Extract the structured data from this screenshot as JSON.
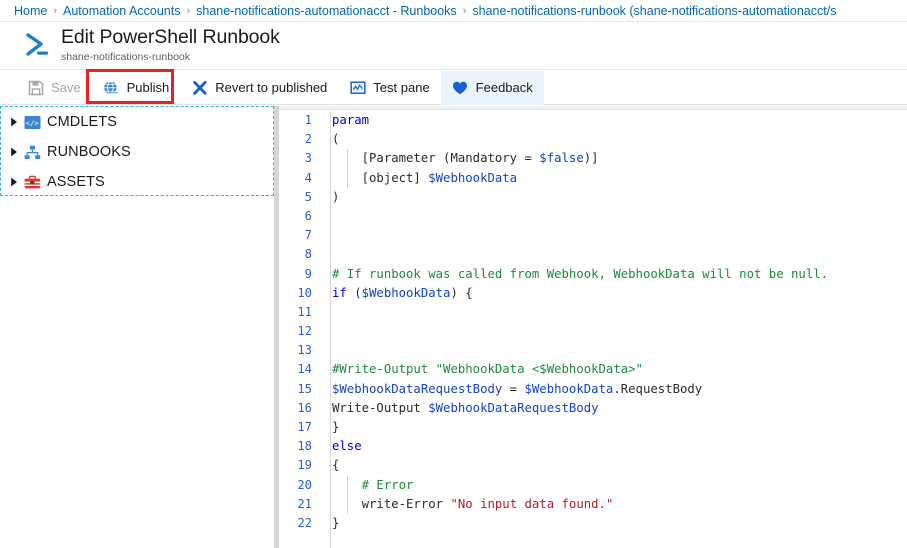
{
  "breadcrumb": {
    "items": [
      {
        "label": "Home"
      },
      {
        "label": "Automation Accounts"
      },
      {
        "label": "shane-notifications-automationacct - Runbooks"
      },
      {
        "label": "shane-notifications-runbook (shane-notifications-automationacct/s"
      }
    ],
    "separator": "›"
  },
  "header": {
    "title": "Edit PowerShell Runbook",
    "subtitle": "shane-notifications-runbook",
    "icon": "powershell-prompt-icon"
  },
  "toolbar": {
    "buttons": [
      {
        "label": "Save",
        "icon": "save-floppy-icon",
        "disabled": true,
        "hovered": false
      },
      {
        "label": "Publish",
        "icon": "publish-globe-icon",
        "disabled": false,
        "hovered": false,
        "highlighted": true
      },
      {
        "label": "Revert to published",
        "icon": "revert-x-icon",
        "disabled": false,
        "hovered": false
      },
      {
        "label": "Test pane",
        "icon": "test-pane-monitor-icon",
        "disabled": false,
        "hovered": false
      },
      {
        "label": "Feedback",
        "icon": "feedback-heart-icon",
        "disabled": false,
        "hovered": true
      }
    ]
  },
  "annotation": {
    "color": "#e8201f",
    "target": "Publish"
  },
  "sidebar": {
    "items": [
      {
        "label": "CMDLETS",
        "icon": "code-brackets-icon",
        "expanded": false
      },
      {
        "label": "RUNBOOKS",
        "icon": "hierarchy-org-icon",
        "expanded": false
      },
      {
        "label": "ASSETS",
        "icon": "toolbox-icon",
        "expanded": false
      }
    ],
    "border_color": "#2ab3e8"
  },
  "editor": {
    "language": "PowerShell",
    "line_count": 22,
    "colors": {
      "keyword": "#0000d0",
      "variable": "#1344c4",
      "comment": "#1f8a3c",
      "string": "#b02030",
      "plain": "#2b2b2b",
      "line_number": "#2b5fd9"
    },
    "lines": [
      {
        "n": 1,
        "tokens": [
          {
            "t": "param",
            "c": "key"
          }
        ]
      },
      {
        "n": 2,
        "tokens": [
          {
            "t": "(",
            "c": "plain"
          }
        ]
      },
      {
        "n": 3,
        "tokens": [
          {
            "t": "    [Parameter (Mandatory = ",
            "c": "plain"
          },
          {
            "t": "$false",
            "c": "var"
          },
          {
            "t": ")]",
            "c": "plain"
          }
        ]
      },
      {
        "n": 4,
        "tokens": [
          {
            "t": "    [object] ",
            "c": "plain"
          },
          {
            "t": "$WebhookData",
            "c": "var"
          }
        ]
      },
      {
        "n": 5,
        "tokens": [
          {
            "t": ")",
            "c": "plain"
          }
        ]
      },
      {
        "n": 6,
        "tokens": []
      },
      {
        "n": 7,
        "tokens": []
      },
      {
        "n": 8,
        "tokens": []
      },
      {
        "n": 9,
        "tokens": [
          {
            "t": "# If runbook was called from Webhook, WebhookData will not be null.",
            "c": "cmt"
          }
        ]
      },
      {
        "n": 10,
        "tokens": [
          {
            "t": "if",
            "c": "key"
          },
          {
            "t": " (",
            "c": "plain"
          },
          {
            "t": "$WebhookData",
            "c": "var"
          },
          {
            "t": ") {",
            "c": "plain"
          }
        ]
      },
      {
        "n": 11,
        "tokens": []
      },
      {
        "n": 12,
        "tokens": []
      },
      {
        "n": 13,
        "tokens": []
      },
      {
        "n": 14,
        "tokens": [
          {
            "t": "#Write-Output \"WebhookData <$WebhookData>\"",
            "c": "cmt"
          }
        ]
      },
      {
        "n": 15,
        "tokens": [
          {
            "t": "$WebhookDataRequestBody",
            "c": "var"
          },
          {
            "t": " = ",
            "c": "plain"
          },
          {
            "t": "$WebhookData",
            "c": "var"
          },
          {
            "t": ".RequestBody",
            "c": "plain"
          }
        ]
      },
      {
        "n": 16,
        "tokens": [
          {
            "t": "Write-Output ",
            "c": "plain"
          },
          {
            "t": "$WebhookDataRequestBody",
            "c": "var"
          }
        ]
      },
      {
        "n": 17,
        "tokens": [
          {
            "t": "}",
            "c": "plain"
          }
        ]
      },
      {
        "n": 18,
        "tokens": [
          {
            "t": "else",
            "c": "key"
          }
        ]
      },
      {
        "n": 19,
        "tokens": [
          {
            "t": "{",
            "c": "plain"
          }
        ]
      },
      {
        "n": 20,
        "tokens": [
          {
            "t": "    # Error",
            "c": "cmt"
          }
        ]
      },
      {
        "n": 21,
        "tokens": [
          {
            "t": "    write-Error ",
            "c": "plain"
          },
          {
            "t": "\"No input data found.\"",
            "c": "str"
          }
        ]
      },
      {
        "n": 22,
        "tokens": [
          {
            "t": "}",
            "c": "plain"
          }
        ]
      }
    ]
  }
}
